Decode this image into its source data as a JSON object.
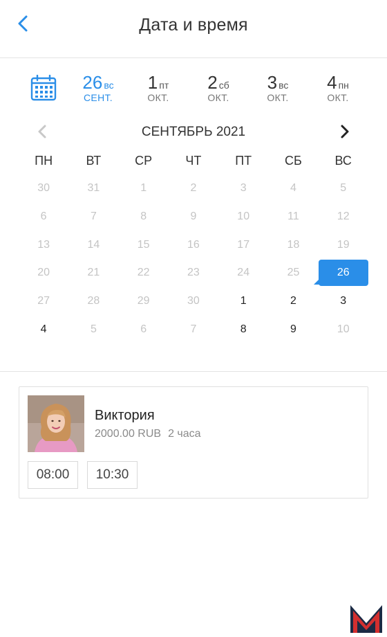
{
  "header": {
    "title": "Дата и время"
  },
  "date_strip": {
    "days": [
      {
        "num": "26",
        "weekday": "вс",
        "month": "СЕНТ.",
        "active": true
      },
      {
        "num": "1",
        "weekday": "пт",
        "month": "ОКТ.",
        "active": false
      },
      {
        "num": "2",
        "weekday": "сб",
        "month": "ОКТ.",
        "active": false
      },
      {
        "num": "3",
        "weekday": "вс",
        "month": "ОКТ.",
        "active": false
      },
      {
        "num": "4",
        "weekday": "пн",
        "month": "ОКТ.",
        "active": false
      }
    ]
  },
  "calendar": {
    "month_title": "СЕНТЯБРЬ 2021",
    "weekdays": [
      "ПН",
      "ВТ",
      "СР",
      "ЧТ",
      "ПТ",
      "СБ",
      "ВС"
    ],
    "weeks": [
      [
        "30",
        "31",
        "1",
        "2",
        "3",
        "4",
        "5"
      ],
      [
        "6",
        "7",
        "8",
        "9",
        "10",
        "11",
        "12"
      ],
      [
        "13",
        "14",
        "15",
        "16",
        "17",
        "18",
        "19"
      ],
      [
        "20",
        "21",
        "22",
        "23",
        "24",
        "25",
        "26"
      ],
      [
        "27",
        "28",
        "29",
        "30",
        "1",
        "2",
        "3"
      ],
      [
        "4",
        "5",
        "6",
        "7",
        "8",
        "9",
        "10"
      ]
    ],
    "available": [
      [
        4,
        4
      ],
      [
        4,
        5
      ],
      [
        4,
        6
      ],
      [
        5,
        0
      ],
      [
        5,
        4
      ],
      [
        5,
        5
      ]
    ],
    "selected": [
      3,
      6
    ],
    "marked": [
      3,
      5
    ]
  },
  "booking": {
    "name": "Виктория",
    "price": "2000.00 RUB",
    "duration": "2 часа",
    "slots": [
      "08:00",
      "10:30"
    ]
  },
  "colors": {
    "accent": "#2a8ee8",
    "logo_red": "#d32f2f",
    "logo_dark": "#1b2a44"
  }
}
